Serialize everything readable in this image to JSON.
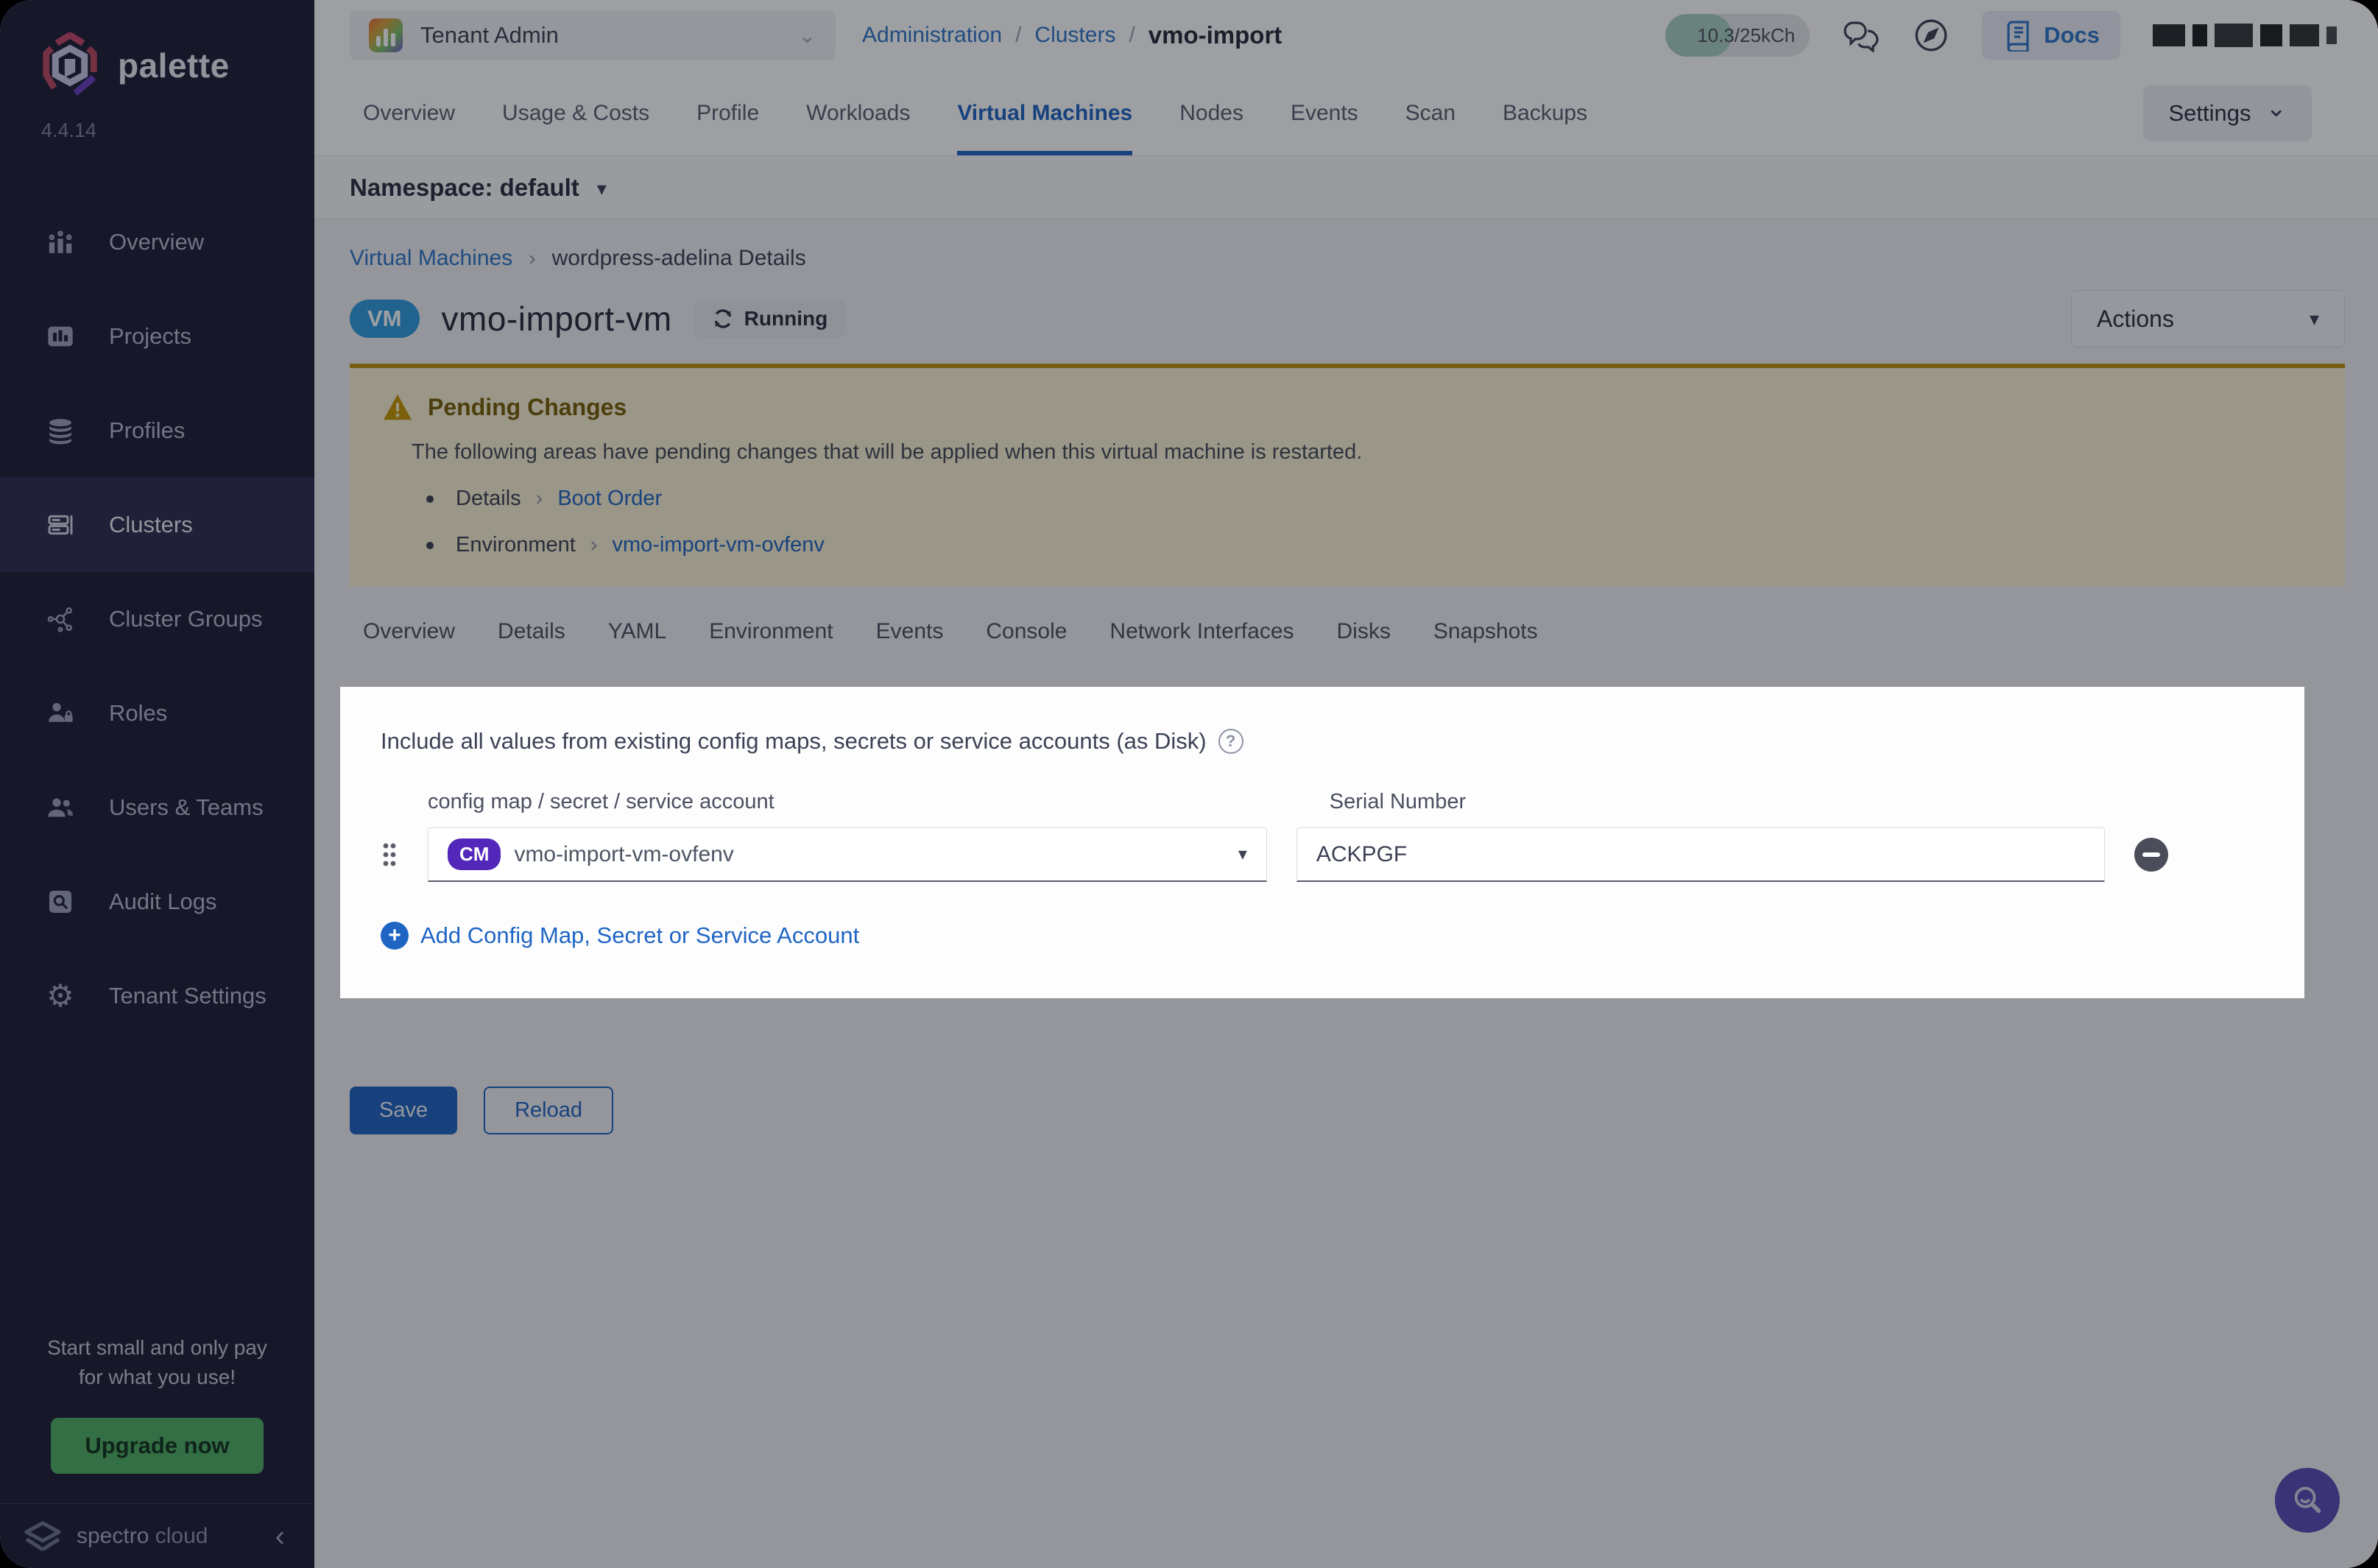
{
  "brand": {
    "name": "palette",
    "version": "4.4.14"
  },
  "sidebar": {
    "items": [
      {
        "label": "Overview"
      },
      {
        "label": "Projects"
      },
      {
        "label": "Profiles"
      },
      {
        "label": "Clusters"
      },
      {
        "label": "Cluster Groups"
      },
      {
        "label": "Roles"
      },
      {
        "label": "Users & Teams"
      },
      {
        "label": "Audit Logs"
      },
      {
        "label": "Tenant Settings"
      }
    ],
    "upsell": {
      "line1": "Start small and only pay",
      "line2": "for what you use!",
      "cta": "Upgrade now"
    },
    "footer": {
      "brand_first": "spectro",
      "brand_second": "cloud",
      "collapse_glyph": "‹"
    }
  },
  "topbar": {
    "scope_label": "Tenant Admin",
    "breadcrumb": {
      "item1": "Administration",
      "item2": "Clusters",
      "current": "vmo-import",
      "sep": "/"
    },
    "usage_text": "10.3/25kCh",
    "docs_label": "Docs"
  },
  "cluster_tabs": {
    "items": [
      {
        "label": "Overview"
      },
      {
        "label": "Usage & Costs"
      },
      {
        "label": "Profile"
      },
      {
        "label": "Workloads"
      },
      {
        "label": "Virtual Machines"
      },
      {
        "label": "Nodes"
      },
      {
        "label": "Events"
      },
      {
        "label": "Scan"
      },
      {
        "label": "Backups"
      }
    ],
    "settings_label": "Settings"
  },
  "namespace_bar": {
    "text": "Namespace: default"
  },
  "vm_page": {
    "breadcrumb": {
      "parent": "Virtual Machines",
      "sep": "›",
      "current": "wordpress-adelina Details"
    },
    "kind_badge": "VM",
    "title": "vmo-import-vm",
    "status": "Running",
    "actions_label": "Actions",
    "pending": {
      "title": "Pending Changes",
      "message": "The following areas have pending changes that will be applied when this virtual machine is restarted.",
      "item1": {
        "area": "Details",
        "sep": "›",
        "link": "Boot Order"
      },
      "item2": {
        "area": "Environment",
        "sep": "›",
        "link": "vmo-import-vm-ovfenv"
      }
    },
    "tabs": [
      {
        "label": "Overview"
      },
      {
        "label": "Details"
      },
      {
        "label": "YAML"
      },
      {
        "label": "Environment"
      },
      {
        "label": "Events"
      },
      {
        "label": "Console"
      },
      {
        "label": "Network Interfaces"
      },
      {
        "label": "Disks"
      },
      {
        "label": "Snapshots"
      }
    ]
  },
  "env_panel": {
    "title": "Include all values from existing config maps, secrets or service accounts (as Disk)",
    "help_glyph": "?",
    "col1_label": "config map / secret / service account",
    "col2_label": "Serial Number",
    "row": {
      "badge": "CM",
      "value": "vmo-import-vm-ovfenv",
      "serial": "ACKPGF"
    },
    "add_label": "Add Config Map, Secret or Service Account"
  },
  "footer_actions": {
    "save": "Save",
    "reload": "Reload"
  },
  "glyphs": {
    "caret_down": "▾",
    "chevron_down": "⌄",
    "gear": "⚙"
  },
  "colors": {
    "primary_blue": "#1f65c4",
    "vm_badge_blue": "#2f9ce0",
    "cm_badge_purple": "#5227ba",
    "pending_gold": "#bd9210",
    "upgrade_green": "#4fae63",
    "sidebar_bg": "#1d1e38",
    "launcher_purple": "#5a4bb5"
  }
}
